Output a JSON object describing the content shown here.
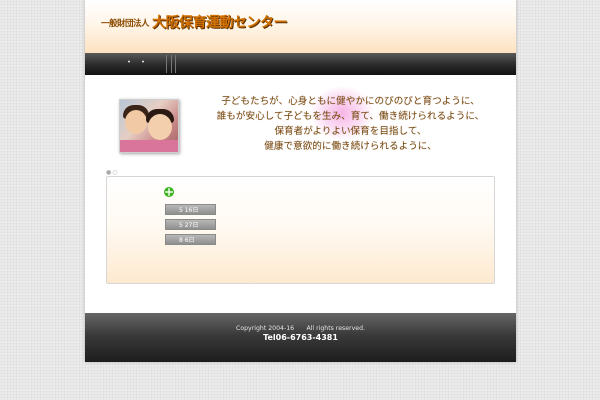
{
  "header": {
    "org_prefix": "一般財団法人",
    "org_name": "大阪保育運動センター"
  },
  "nav": {
    "items": [
      "・",
      "・"
    ]
  },
  "hero": {
    "message_lines": [
      "子どもたちが、心身ともに健やかにのびのびと育つように、",
      "誰もが安心して子どもを生み、育て、働き続けられるように、",
      "保育者がよりよい保育を目指して、",
      "健康で意欲的に働き続けられるように、"
    ]
  },
  "slider": {
    "pager": "●○"
  },
  "news": {
    "items": [
      {
        "label": "5 16日"
      },
      {
        "label": "5 27日"
      },
      {
        "label": "8 6日"
      }
    ]
  },
  "footer": {
    "copyright": "Copyright 2004-16　　All rights reserved.",
    "tel": "Tel06-6763-4381"
  },
  "colors": {
    "accent_orange": "#d07000",
    "text_brown": "#7a4a12",
    "icon_green": "#3cb521"
  }
}
